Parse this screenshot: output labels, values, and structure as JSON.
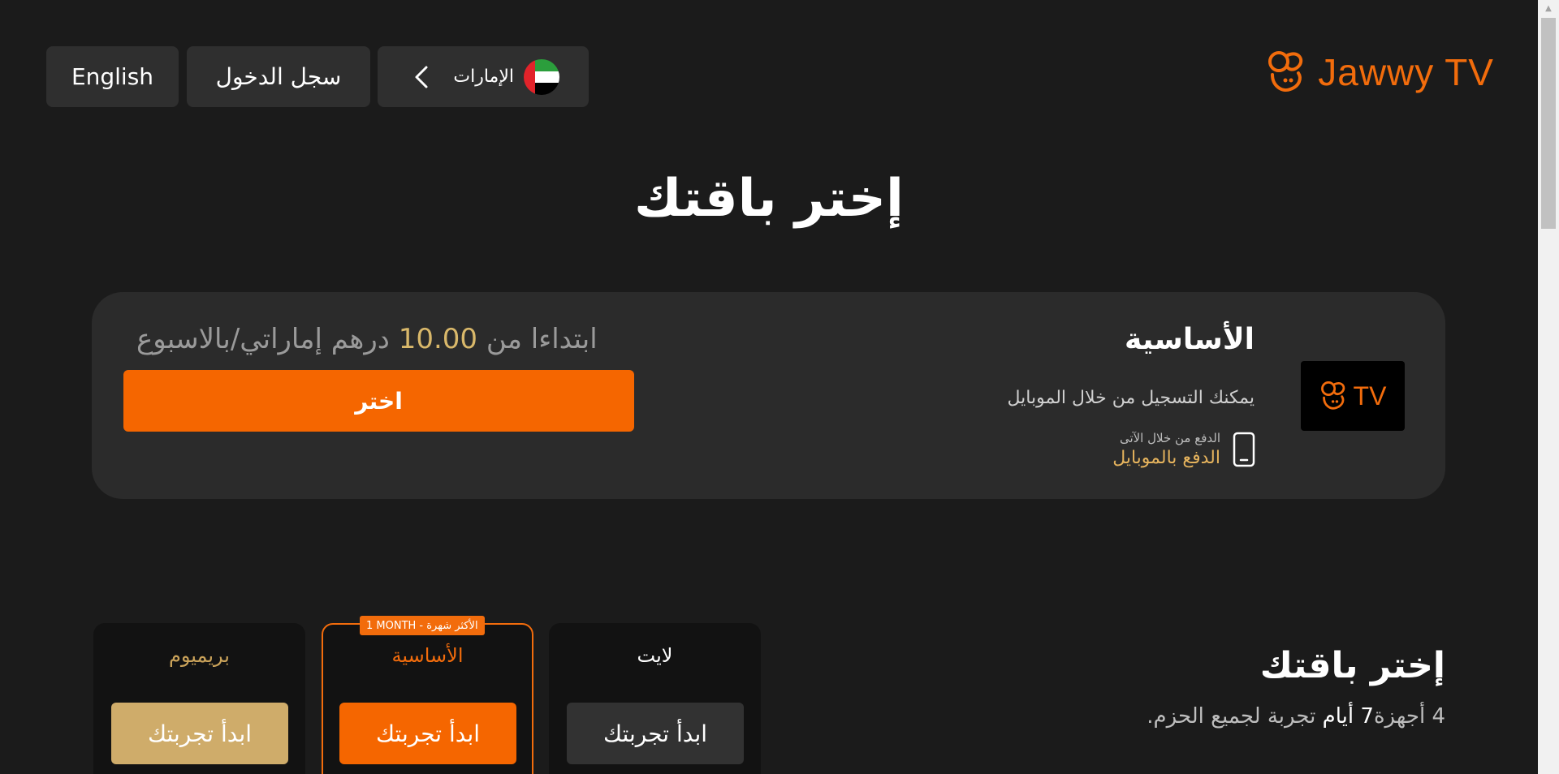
{
  "header": {
    "language_label": "English",
    "login_label": "سجل الدخول",
    "country_label": "الإمارات",
    "logo_text": "Jawwy TV"
  },
  "main": {
    "title": "إختر باقتك"
  },
  "plan_card": {
    "name": "الأساسية",
    "description": "يمكنك التسجيل من خلال الموبايل",
    "payment_caption": "الدفع من خلال الآتى",
    "payment_method": "الدفع بالموبايل",
    "price_prefix": "ابتداءا من",
    "price_value": "10.00",
    "price_suffix": "درهم إماراتي/بالاسبوع",
    "select_label": "اختر",
    "logo_text": "TV"
  },
  "tiers": [
    {
      "name": "لايت",
      "button_label": "ابدأ تجربتك"
    },
    {
      "name": "الأساسية",
      "button_label": "ابدأ تجربتك",
      "badge": "1 MONTH - الأكثر شهرة"
    },
    {
      "name": "بريميوم",
      "button_label": "ابدأ تجربتك"
    }
  ],
  "trial": {
    "title": "إختر باقتك",
    "devices": "4 أجهزة",
    "days": "7 أيام",
    "rest": "تجربة لجميع الحزم."
  },
  "colors": {
    "accent": "#f56600",
    "gold": "#cfac6a",
    "background": "#1b1b1b"
  }
}
